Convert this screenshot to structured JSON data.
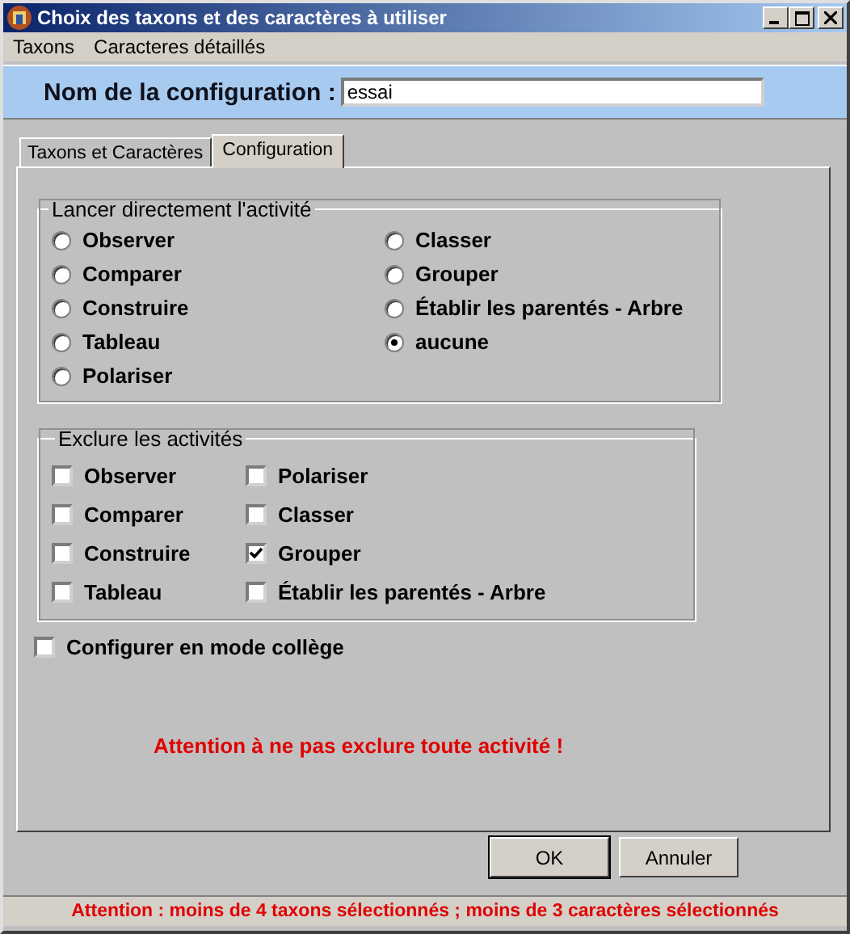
{
  "window": {
    "title": "Choix des taxons et des caractères à utiliser"
  },
  "menu": [
    "Taxons",
    "Caracteres détaillés"
  ],
  "config_name": {
    "label": "Nom de la configuration :",
    "value": "essai"
  },
  "tabs": [
    {
      "label": "Taxons et Caractères",
      "selected": false
    },
    {
      "label": "Configuration",
      "selected": true
    }
  ],
  "launch_group": {
    "title": "Lancer directement l'activité",
    "options": [
      {
        "label": "Observer",
        "selected": false
      },
      {
        "label": "Comparer",
        "selected": false
      },
      {
        "label": "Construire",
        "selected": false
      },
      {
        "label": "Tableau",
        "selected": false
      },
      {
        "label": "Polariser",
        "selected": false
      },
      {
        "label": "Classer",
        "selected": false
      },
      {
        "label": "Grouper",
        "selected": false
      },
      {
        "label": "Établir les parentés - Arbre",
        "selected": false
      },
      {
        "label": "aucune",
        "selected": true
      }
    ]
  },
  "exclude_group": {
    "title": "Exclure les activités",
    "options": [
      {
        "label": "Observer",
        "checked": false
      },
      {
        "label": "Comparer",
        "checked": false
      },
      {
        "label": "Construire",
        "checked": false
      },
      {
        "label": "Tableau",
        "checked": false
      },
      {
        "label": "Polariser",
        "checked": false
      },
      {
        "label": "Classer",
        "checked": false
      },
      {
        "label": "Grouper",
        "checked": true
      },
      {
        "label": "Établir les parentés - Arbre",
        "checked": false
      }
    ]
  },
  "college_mode": {
    "label": "Configurer en mode collège",
    "checked": false
  },
  "warning": "Attention à ne pas exclure toute activité !",
  "buttons": [
    "OK",
    "Annuler"
  ],
  "status_bar": "Attention : moins de 4 taxons sélectionnés ; moins de 3 caractères sélectionnés"
}
